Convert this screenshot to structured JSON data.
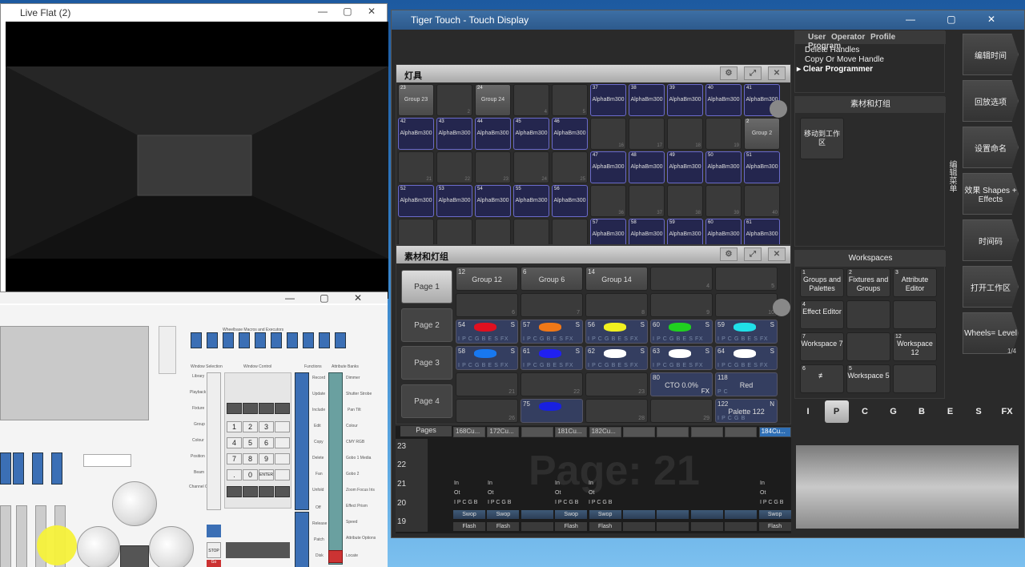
{
  "live_flat": {
    "title": "Live Flat (2)"
  },
  "tiger_touch": {
    "title": "Tiger Touch - Touch Display",
    "fixtures_window": {
      "title": "灯具",
      "cells": [
        {
          "n": "23",
          "label": "Group 23",
          "type": "grp"
        },
        {
          "n": "",
          "label": "",
          "type": "empty",
          "c": "2"
        },
        {
          "n": "24",
          "label": "Group 24",
          "type": "grp"
        },
        {
          "n": "",
          "label": "",
          "type": "empty",
          "c": "4"
        },
        {
          "n": "",
          "label": "",
          "type": "empty",
          "c": "5"
        },
        {
          "n": "37",
          "label": "AlphaBm300",
          "type": "alpha"
        },
        {
          "n": "38",
          "label": "AlphaBm300",
          "type": "alpha"
        },
        {
          "n": "39",
          "label": "AlphaBm300",
          "type": "alpha"
        },
        {
          "n": "40",
          "label": "AlphaBm300",
          "type": "alpha"
        },
        {
          "n": "41",
          "label": "AlphaBm300",
          "type": "alpha"
        },
        {
          "n": "42",
          "label": "AlphaBm300",
          "type": "alpha"
        },
        {
          "n": "43",
          "label": "AlphaBm300",
          "type": "alpha"
        },
        {
          "n": "44",
          "label": "AlphaBm300",
          "type": "alpha"
        },
        {
          "n": "45",
          "label": "AlphaBm300",
          "type": "alpha"
        },
        {
          "n": "46",
          "label": "AlphaBm300",
          "type": "alpha"
        },
        {
          "n": "",
          "label": "",
          "type": "empty",
          "c": "16"
        },
        {
          "n": "",
          "label": "",
          "type": "empty",
          "c": "17"
        },
        {
          "n": "",
          "label": "",
          "type": "empty",
          "c": "18"
        },
        {
          "n": "",
          "label": "",
          "type": "empty",
          "c": "19"
        },
        {
          "n": "2",
          "label": "Group 2",
          "type": "grp"
        },
        {
          "n": "",
          "label": "",
          "type": "empty",
          "c": "21"
        },
        {
          "n": "",
          "label": "",
          "type": "empty",
          "c": "22"
        },
        {
          "n": "",
          "label": "",
          "type": "empty",
          "c": "23"
        },
        {
          "n": "",
          "label": "",
          "type": "empty",
          "c": "24"
        },
        {
          "n": "",
          "label": "",
          "type": "empty",
          "c": "25"
        },
        {
          "n": "47",
          "label": "AlphaBm300",
          "type": "alpha"
        },
        {
          "n": "48",
          "label": "AlphaBm300",
          "type": "alpha"
        },
        {
          "n": "49",
          "label": "AlphaBm300",
          "type": "alpha"
        },
        {
          "n": "50",
          "label": "AlphaBm300",
          "type": "alpha"
        },
        {
          "n": "51",
          "label": "AlphaBm300",
          "type": "alpha"
        },
        {
          "n": "52",
          "label": "AlphaBm300",
          "type": "alpha"
        },
        {
          "n": "53",
          "label": "AlphaBm300",
          "type": "alpha"
        },
        {
          "n": "54",
          "label": "AlphaBm300",
          "type": "alpha"
        },
        {
          "n": "55",
          "label": "AlphaBm300",
          "type": "alpha"
        },
        {
          "n": "56",
          "label": "AlphaBm300",
          "type": "alpha"
        },
        {
          "n": "",
          "label": "",
          "type": "empty",
          "c": "36"
        },
        {
          "n": "",
          "label": "",
          "type": "empty",
          "c": "37"
        },
        {
          "n": "",
          "label": "",
          "type": "empty",
          "c": "38"
        },
        {
          "n": "",
          "label": "",
          "type": "empty",
          "c": "39"
        },
        {
          "n": "",
          "label": "",
          "type": "empty",
          "c": "40"
        },
        {
          "n": "",
          "label": "",
          "type": "empty"
        },
        {
          "n": "",
          "label": "",
          "type": "empty"
        },
        {
          "n": "",
          "label": "",
          "type": "empty"
        },
        {
          "n": "",
          "label": "",
          "type": "empty"
        },
        {
          "n": "",
          "label": "",
          "type": "empty"
        },
        {
          "n": "57",
          "label": "AlphaBm300",
          "type": "alpha"
        },
        {
          "n": "58",
          "label": "AlphaBm300",
          "type": "alpha"
        },
        {
          "n": "59",
          "label": "AlphaBm300",
          "type": "alpha"
        },
        {
          "n": "60",
          "label": "AlphaBm300",
          "type": "alpha"
        },
        {
          "n": "61",
          "label": "AlphaBm300",
          "type": "alpha"
        }
      ]
    },
    "palettes_window": {
      "title": "素材和灯组",
      "pages": [
        "Page 1",
        "Page 2",
        "Page 3",
        "Page 4"
      ],
      "cells": [
        {
          "n": "12",
          "label": "Group 12",
          "type": "grp"
        },
        {
          "n": "6",
          "label": "Group 6",
          "type": "grp"
        },
        {
          "n": "14",
          "label": "Group 14",
          "type": "grp"
        },
        {
          "type": "empty",
          "c": "4"
        },
        {
          "type": "empty",
          "c": "5"
        },
        {
          "type": "empty",
          "c": "6"
        },
        {
          "type": "empty",
          "c": "7"
        },
        {
          "type": "empty",
          "c": "8"
        },
        {
          "type": "empty",
          "c": "9"
        },
        {
          "type": "empty",
          "c": "10"
        },
        {
          "n": "54",
          "s": "S",
          "type": "pal",
          "color": "#e01020",
          "attr": "I P C G B E S FX"
        },
        {
          "n": "57",
          "s": "S",
          "type": "pal",
          "color": "#f07818",
          "attr": "I P C G B E S FX"
        },
        {
          "n": "56",
          "s": "S",
          "type": "pal",
          "color": "#f0f020",
          "attr": "I P C G B E S FX"
        },
        {
          "n": "60",
          "s": "S",
          "type": "pal",
          "color": "#20d020",
          "attr": "I P C G B E S FX"
        },
        {
          "n": "59",
          "s": "S",
          "type": "pal",
          "color": "#20e0e8",
          "attr": "I P C G B E S FX"
        },
        {
          "n": "58",
          "s": "S",
          "type": "pal",
          "color": "#1878f0",
          "attr": "I P C G B E S FX"
        },
        {
          "n": "61",
          "s": "S",
          "type": "pal",
          "color": "#2020f0",
          "attr": "I P C G B E S FX"
        },
        {
          "n": "62",
          "s": "S",
          "type": "pal",
          "color": "#ffffff",
          "attr": "I P C G B E S FX"
        },
        {
          "n": "63",
          "s": "S",
          "type": "pal",
          "color": "#ffffff",
          "attr": "I P C G B E S FX"
        },
        {
          "n": "64",
          "s": "S",
          "type": "pal",
          "color": "#ffffff",
          "attr": "I P C G B E S FX"
        },
        {
          "type": "empty",
          "c": "21"
        },
        {
          "type": "empty",
          "c": "22"
        },
        {
          "type": "empty",
          "c": "23"
        },
        {
          "n": "80",
          "label": "CTO 0.0%",
          "s": "",
          "type": "pal",
          "fx": "FX"
        },
        {
          "n": "118",
          "label": "Red",
          "s": "",
          "type": "pal",
          "attr": "P C"
        },
        {
          "type": "empty",
          "c": "26"
        },
        {
          "n": "75",
          "s": "",
          "type": "pal",
          "color": "#1820e0",
          "attr": ""
        },
        {
          "type": "empty",
          "c": "28"
        },
        {
          "type": "empty",
          "c": "29"
        },
        {
          "n": "122",
          "label": "Palette 122",
          "s": "N",
          "type": "pal",
          "attr": "I P C G B"
        }
      ]
    },
    "menu_panel": {
      "tabs": [
        "User",
        "Operator",
        "Profile",
        "Program"
      ],
      "items": [
        "Delete Handles",
        "Copy Or Move Handle",
        "Clear Programmer"
      ]
    },
    "groups_panel": {
      "title": "素材和灯组",
      "button": "移动到工作区"
    },
    "workspaces": {
      "title": "Workspaces",
      "cells": [
        {
          "n": "1",
          "label": "Groups and Palettes"
        },
        {
          "n": "2",
          "label": "Fixtures and Groups"
        },
        {
          "n": "3",
          "label": "Attribute Editor"
        },
        {
          "n": "4",
          "label": "Effect Editor"
        },
        {
          "n": "",
          "label": ""
        },
        {
          "n": "",
          "label": ""
        },
        {
          "n": "7",
          "label": "Workspace 7"
        },
        {
          "n": "",
          "label": ""
        },
        {
          "n": "12",
          "label": "Workspace 12"
        },
        {
          "n": "6",
          "label": "≢"
        },
        {
          "n": "5",
          "label": "Workspace 5"
        },
        {
          "n": "",
          "label": ""
        }
      ]
    },
    "right_buttons": [
      "编辑时间",
      "回放选项",
      "设置命名",
      "效果 Shapes + Effects",
      "时间码",
      "打开工作区",
      "Wheels= Level"
    ],
    "right_page_indicator": "1/4",
    "side_label": "编辑菜单",
    "attribute_bar": [
      "I",
      "P",
      "C",
      "G",
      "B",
      "E",
      "S",
      "FX"
    ],
    "attribute_selected": "P",
    "pages_bar": {
      "label": "Pages",
      "tabs": [
        "168Cu...",
        "172Cu...",
        "",
        "181Cu...",
        "182Cu...",
        "",
        "",
        "",
        "",
        "184Cu..."
      ],
      "page_numbers": [
        "23",
        "22",
        "21",
        "20",
        "19"
      ],
      "big_text": "Page: 21"
    },
    "playbacks": {
      "swop": "Swop",
      "flash": "Flash",
      "attrs": "I P C G B",
      "in": "In",
      "out": "Ot"
    }
  },
  "console_window": {
    "labels": [
      "Wheelbase Macros and Executors",
      "Window Selection",
      "Window Control",
      "Functions",
      "Attribute Banks",
      "Library",
      "Playback",
      "Fixture",
      "Group",
      "Colour",
      "Position",
      "Beam",
      "Channel Grid",
      "Record",
      "Update",
      "Include",
      "Edit",
      "Copy",
      "Delete",
      "Fan",
      "Unfold",
      "Off",
      "Release",
      "Patch",
      "Disk",
      "Dimmer",
      "Shutter Strobe",
      "Pan Tilt",
      "Colour",
      "CMY RGB",
      "Gobo 1 Media",
      "Gobo 2",
      "Zoom Focus Iris",
      "Effect Prism",
      "Speed",
      "Attribute Options",
      "Locate",
      "STOP",
      "Go"
    ],
    "keypad": [
      "1",
      "2",
      "3",
      "4",
      "5",
      "6",
      "7",
      "8",
      "9",
      ".",
      "0",
      "ENTER"
    ]
  }
}
